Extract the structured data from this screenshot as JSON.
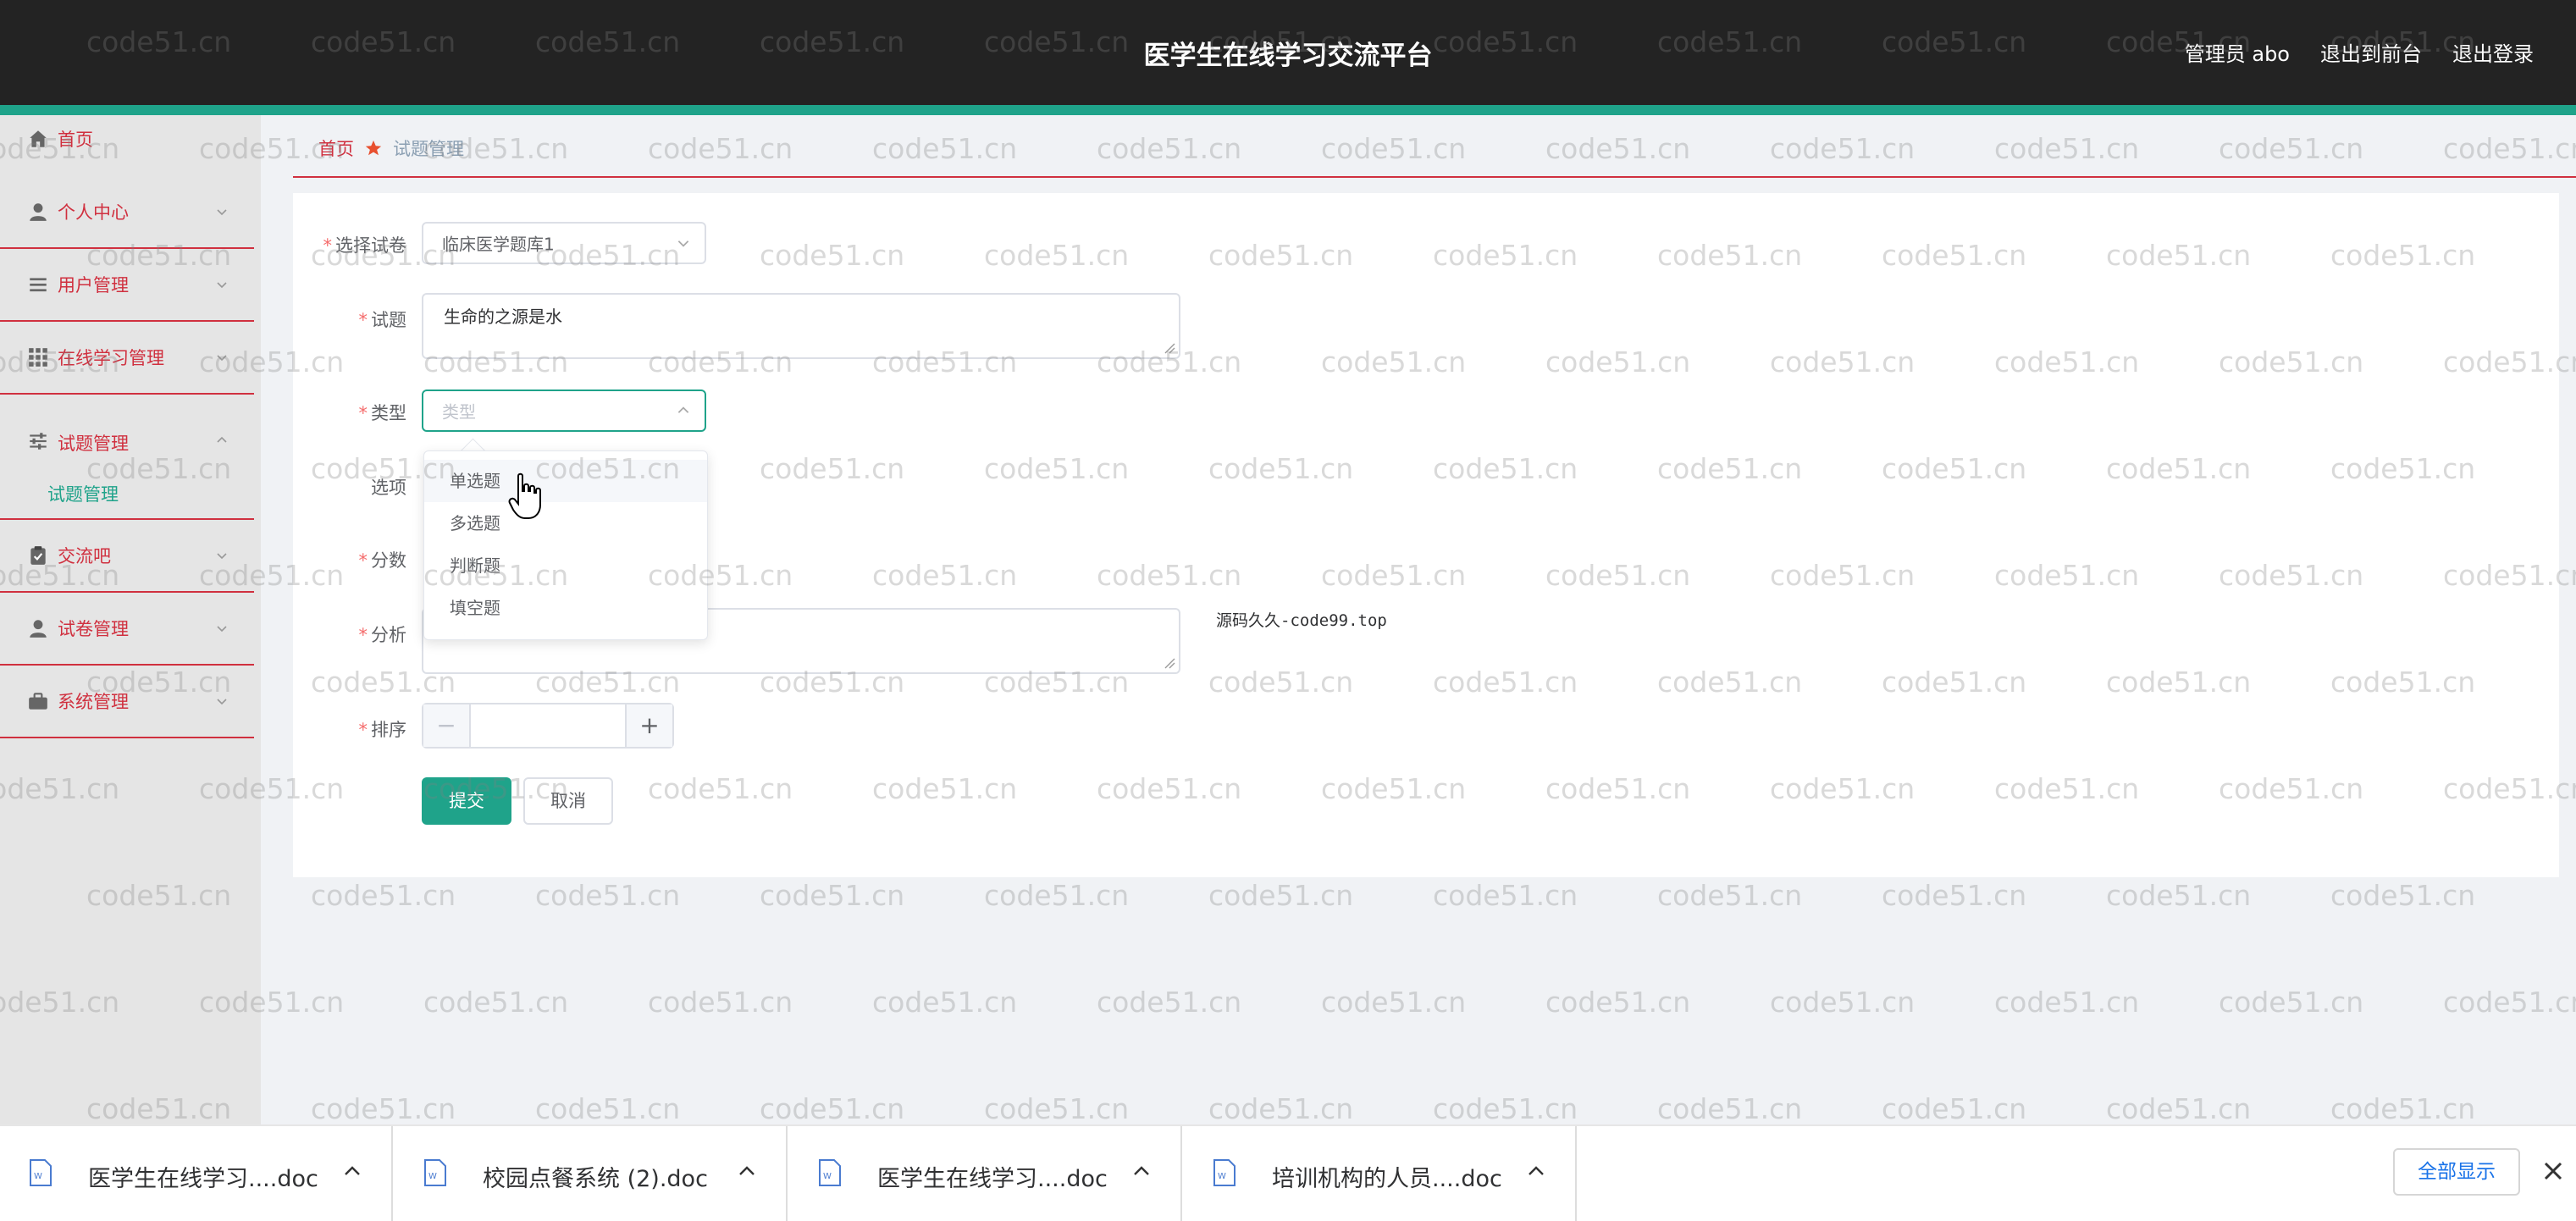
{
  "header": {
    "title": "医学生在线学习交流平台",
    "admin": "管理员 abo",
    "exit_front": "退出到前台",
    "logout": "退出登录"
  },
  "sidebar": {
    "items": [
      {
        "label": "首页",
        "icon": "home-icon"
      },
      {
        "label": "个人中心",
        "icon": "user-icon"
      },
      {
        "label": "用户管理",
        "icon": "list-icon"
      },
      {
        "label": "在线学习管理",
        "icon": "grid-icon"
      },
      {
        "label": "试题管理",
        "icon": "sliders-icon",
        "expanded": true
      },
      {
        "label": "交流吧",
        "icon": "clipboard-icon"
      },
      {
        "label": "试卷管理",
        "icon": "user-icon"
      },
      {
        "label": "系统管理",
        "icon": "briefcase-icon"
      }
    ],
    "submenu": "试题管理"
  },
  "breadcrumb": {
    "home": "首页",
    "current": "试题管理"
  },
  "form": {
    "paper_label": "选择试卷",
    "paper_value": "临床医学题库1",
    "question_label": "试题",
    "question_value": "生命的之源是水",
    "type_label": "类型",
    "type_placeholder": "类型",
    "options_label": "选项",
    "score_label": "分数",
    "analysis_label": "分析",
    "order_label": "排序",
    "submit": "提交",
    "cancel": "取消"
  },
  "type_dropdown": {
    "options": [
      "单选题",
      "多选题",
      "判断题",
      "填空题"
    ],
    "hovered": "单选题"
  },
  "side_note": "源码久久-code99.top",
  "watermark": "code51.cn",
  "downloads": {
    "files": [
      "医学生在线学习....doc",
      "校园点餐系统 (2).doc",
      "医学生在线学习....doc",
      "培训机构的人员....doc"
    ],
    "show_all": "全部显示"
  },
  "colors": {
    "header_bg": "#232323",
    "accent": "#1fa38a",
    "menu_text": "#d0303f",
    "required": "#f56c6c"
  }
}
